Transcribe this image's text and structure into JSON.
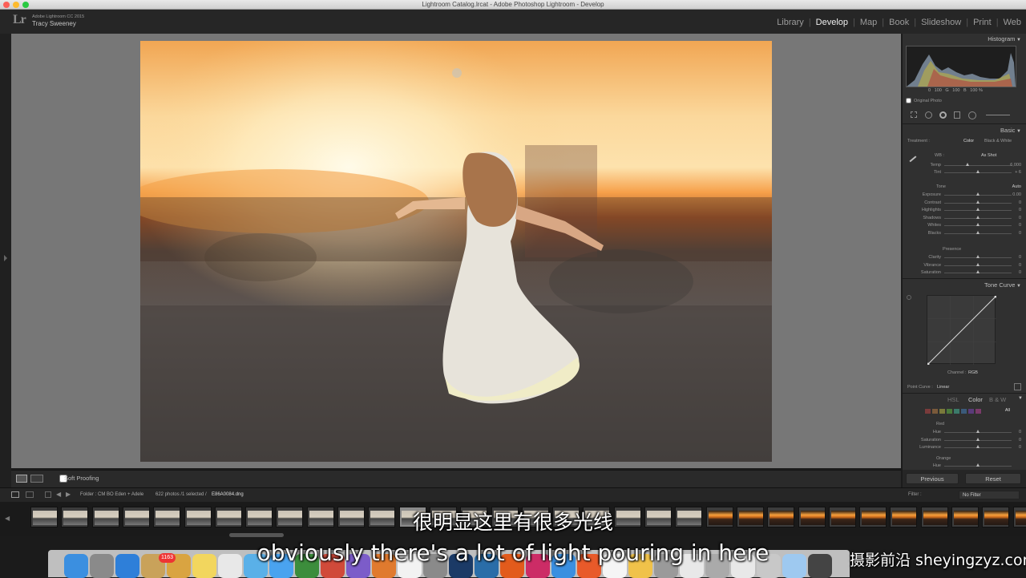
{
  "window": {
    "title": "Lightroom Catalog.lrcat - Adobe Photoshop Lightroom - Develop"
  },
  "identity": {
    "logo": "Lr",
    "version": "Adobe Lightroom CC 2015",
    "user": "Tracy Sweeney"
  },
  "modules": [
    {
      "label": "Library",
      "active": false
    },
    {
      "label": "Develop",
      "active": true
    },
    {
      "label": "Map",
      "active": false
    },
    {
      "label": "Book",
      "active": false
    },
    {
      "label": "Slideshow",
      "active": false
    },
    {
      "label": "Print",
      "active": false
    },
    {
      "label": "Web",
      "active": false
    }
  ],
  "toolbar": {
    "soft_proofing": "Soft Proofing"
  },
  "panels": {
    "histogram": {
      "title": "Histogram",
      "readout": "0   100   G   100   B   100 %",
      "original_photo": "Original Photo"
    },
    "basic": {
      "title": "Basic",
      "treatment_label": "Treatment :",
      "treatment_color": "Color",
      "treatment_bw": "Black & White",
      "wb_label": "WB :",
      "wb_value": "As Shot",
      "temp_tint": [
        {
          "label": "Temp",
          "value": "6,000",
          "pos": 0.35
        },
        {
          "label": "Tint",
          "value": "+ 6",
          "pos": 0.5
        }
      ],
      "tone_label": "Tone",
      "auto_label": "Auto",
      "tone": [
        {
          "label": "Exposure",
          "value": "0.00",
          "pos": 0.5
        },
        {
          "label": "Contrast",
          "value": "0",
          "pos": 0.5
        },
        {
          "label": "Highlights",
          "value": "0",
          "pos": 0.5
        },
        {
          "label": "Shadows",
          "value": "0",
          "pos": 0.5
        },
        {
          "label": "Whites",
          "value": "0",
          "pos": 0.5
        },
        {
          "label": "Blacks",
          "value": "0",
          "pos": 0.5
        }
      ],
      "presence_label": "Presence",
      "presence": [
        {
          "label": "Clarity",
          "value": "0",
          "pos": 0.5
        },
        {
          "label": "Vibrance",
          "value": "0",
          "pos": 0.5
        },
        {
          "label": "Saturation",
          "value": "0",
          "pos": 0.5
        }
      ]
    },
    "tone_curve": {
      "title": "Tone Curve",
      "channel_label": "Channel :",
      "channel_value": "RGB",
      "point_curve_label": "Point Curve :",
      "point_curve_value": "Linear"
    },
    "hsl": {
      "title_left": "HSL",
      "title_mid": "Color",
      "title_right": "B & W",
      "all_label": "All",
      "red_label": "Red",
      "red": [
        {
          "label": "Hue",
          "value": "0",
          "pos": 0.5
        },
        {
          "label": "Saturation",
          "value": "0",
          "pos": 0.5
        },
        {
          "label": "Luminance",
          "value": "0",
          "pos": 0.5
        }
      ],
      "orange_label": "Orange",
      "orange_hue_label": "Hue"
    },
    "previous": "Previous",
    "reset": "Reset"
  },
  "filmstrip_bar": {
    "folder": "Folder : CM BO Eden + Adele",
    "count": "622 photos /1 selected /",
    "filename": "E86A0084.dng",
    "filter_label": "Filter :",
    "filter_value": "No Filter"
  },
  "dock": {
    "badge": "1163"
  },
  "subtitles": {
    "chinese": "很明显这里有很多光线",
    "english": "obviously there's a lot of light pouring in here"
  },
  "watermark": "摄影前沿 sheyingzyz.com"
}
